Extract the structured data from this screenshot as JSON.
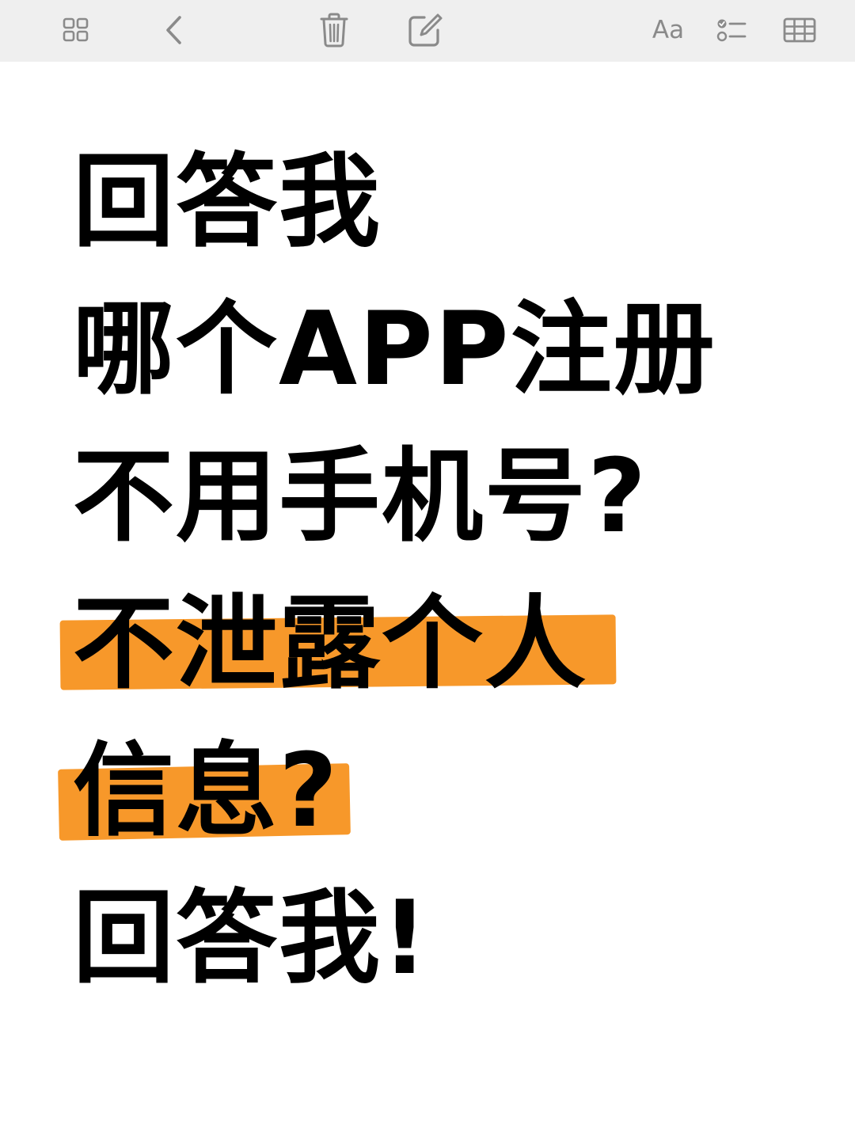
{
  "toolbar": {
    "grid_icon": "grid-icon",
    "back_icon": "chevron-left-icon",
    "trash_icon": "trash-icon",
    "compose_icon": "compose-icon",
    "format_label": "Aa",
    "checklist_icon": "checklist-icon",
    "table_icon": "table-icon",
    "icon_color": "#8a8a8a",
    "background": "#efefef"
  },
  "note": {
    "lines": [
      "回答我",
      "哪个APP注册",
      "不用手机号?",
      "不泄露个人",
      "信息?",
      "回答我!"
    ],
    "highlighted_lines": [
      3,
      4
    ],
    "highlight_color": "#f7982a",
    "text_color": "#000000"
  }
}
